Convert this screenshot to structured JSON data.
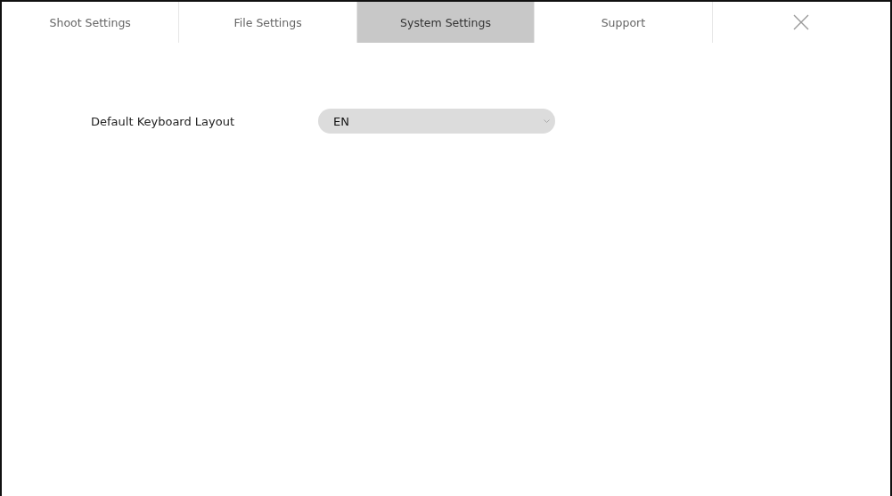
{
  "tabs": [
    {
      "label": "Shoot Settings",
      "selected": false
    },
    {
      "label": "File Settings",
      "selected": false
    },
    {
      "label": "System Settings",
      "selected": true
    },
    {
      "label": "Support",
      "selected": false
    }
  ],
  "settings": [
    {
      "label": "Default Keyboard Layout",
      "value": "EN"
    }
  ]
}
